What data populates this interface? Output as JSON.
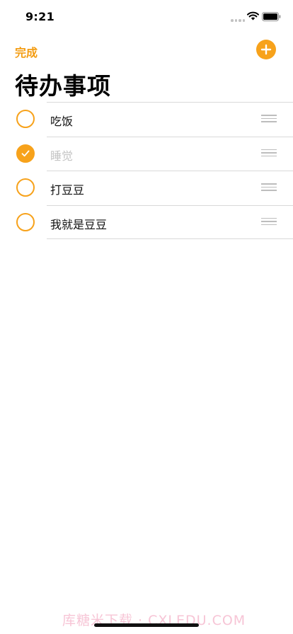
{
  "status": {
    "time": "9:21"
  },
  "nav": {
    "done_label": "完成"
  },
  "header": {
    "title": "待办事项"
  },
  "todos": [
    {
      "text": "吃饭",
      "completed": false
    },
    {
      "text": "睡觉",
      "completed": true
    },
    {
      "text": "打豆豆",
      "completed": false
    },
    {
      "text": "我就是豆豆",
      "completed": false
    }
  ],
  "watermark": "库糖米下载 · CXLEDU.COM",
  "colors": {
    "accent": "#f7a21b",
    "separator": "#d9d9d9",
    "completed_text": "#c4c4c4"
  },
  "icons": [
    "cellular-signal-icon",
    "wifi-icon",
    "battery-icon",
    "add-icon",
    "checkmark-icon",
    "drag-handle-icon"
  ]
}
